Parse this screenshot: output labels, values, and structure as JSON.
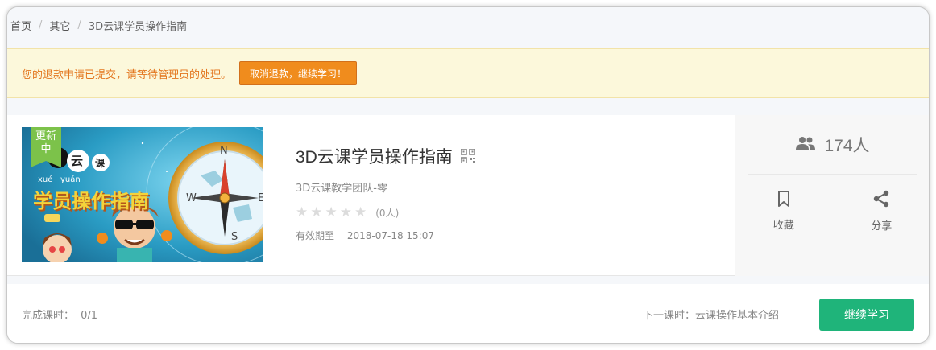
{
  "breadcrumb": {
    "items": [
      {
        "label": "首页"
      },
      {
        "label": "其它"
      },
      {
        "label": "3D云课学员操作指南"
      }
    ],
    "separator": "/"
  },
  "notice": {
    "text": "您的退款申请已提交，请等待管理员的处理。",
    "button_label": "取消退款，继续学习！"
  },
  "course": {
    "badge": "更新中",
    "cover_text": {
      "cloud": "云",
      "lesson": "课",
      "pinyin_1": "xué",
      "pinyin_2": "yuán",
      "headline": "学员操作指南"
    },
    "title": "3D云课学员操作指南",
    "teacher": "3D云课教学团队-零",
    "rating_count": "(0人)",
    "expiry_label": "有效期至",
    "expiry_date": "2018-07-18 15:07",
    "star_count": 5
  },
  "side": {
    "members": "174人",
    "favorite_label": "收藏",
    "share_label": "分享"
  },
  "footer": {
    "progress_label": "完成课时：",
    "progress_value": "0/1",
    "next_lesson": "下一课时：云课操作基本介绍",
    "continue_label": "继续学习"
  },
  "colors": {
    "notice_bg": "#fcf8db",
    "notice_text": "#e3761e",
    "notice_button": "#f08c1d",
    "badge": "#7cc24a",
    "primary_button": "#1fb47a"
  }
}
